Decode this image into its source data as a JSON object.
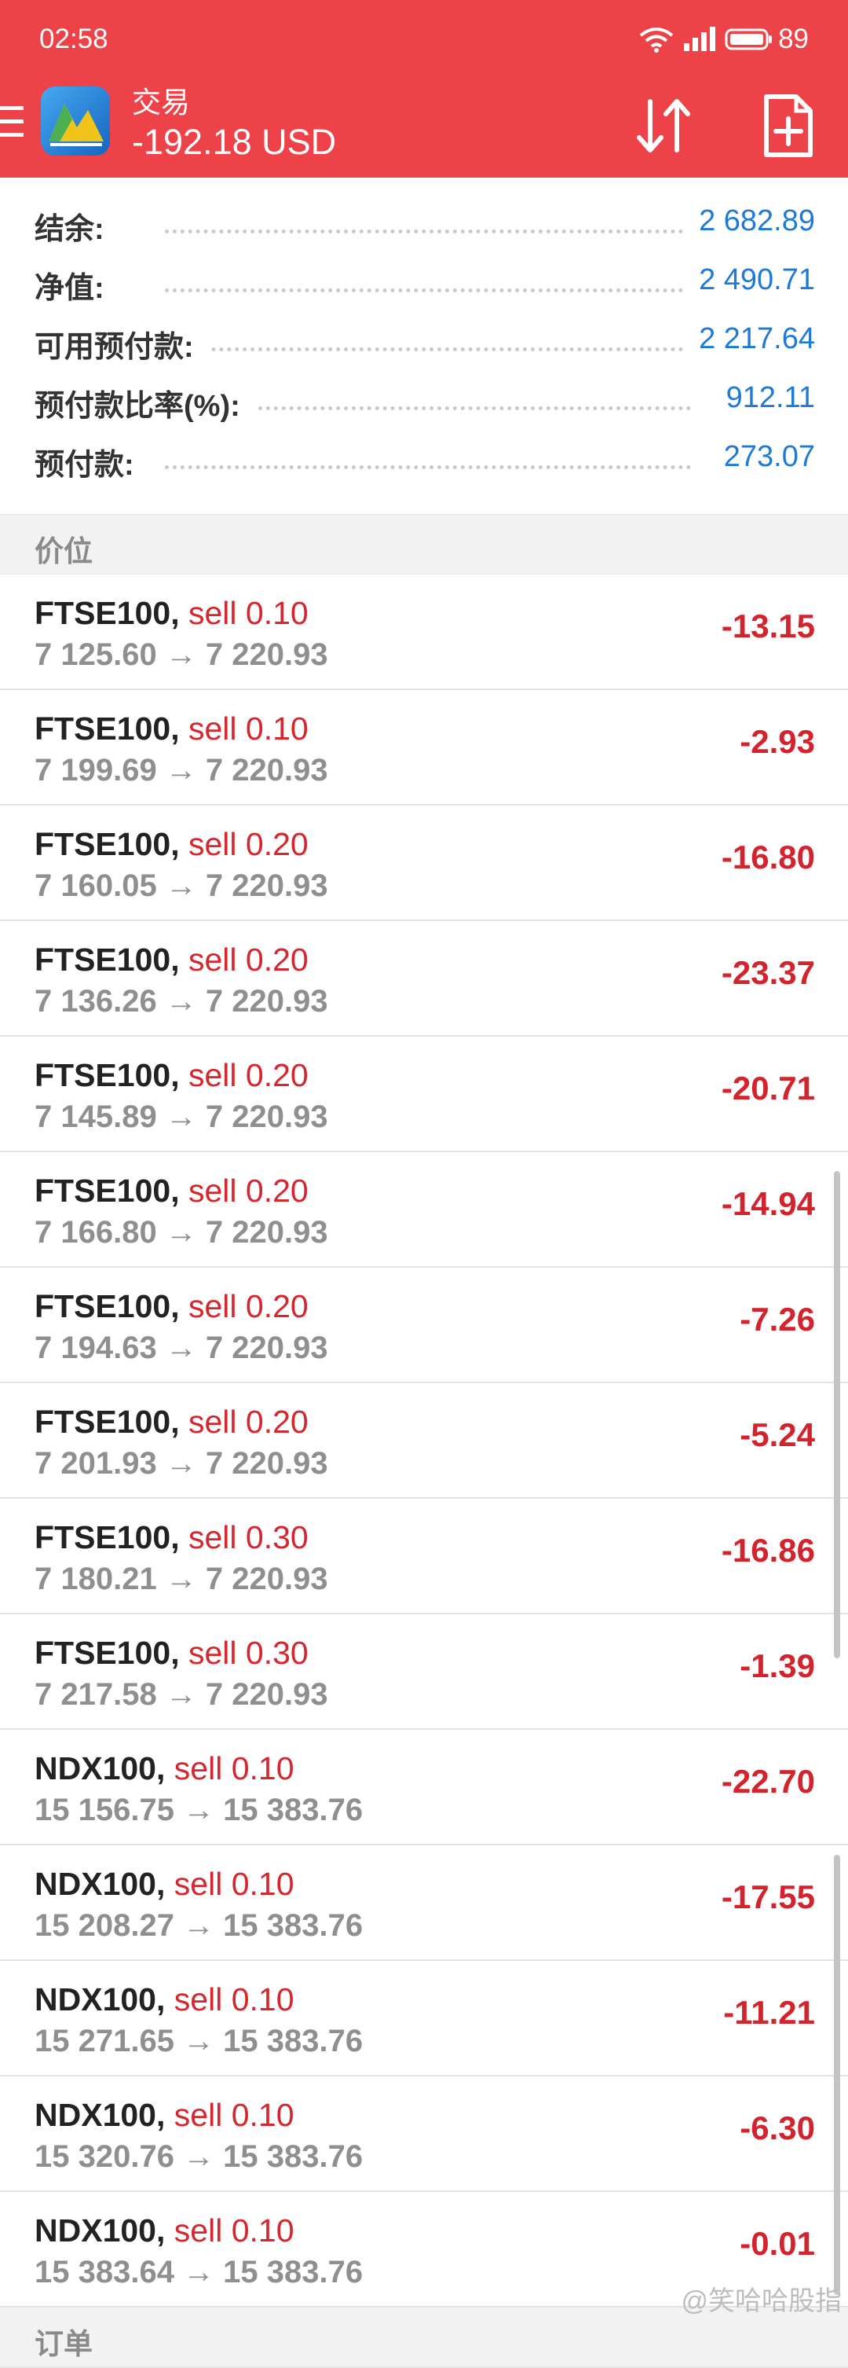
{
  "status_bar": {
    "time": "02:58",
    "battery": "89"
  },
  "header": {
    "title": "交易",
    "balance": "-192.18 USD"
  },
  "summary": [
    {
      "label": "结余:",
      "value": "2 682.89"
    },
    {
      "label": "净值:",
      "value": "2 490.71"
    },
    {
      "label": "可用预付款:",
      "value": "2 217.64"
    },
    {
      "label": "预付款比率(%):",
      "value": "912.11"
    },
    {
      "label": "预付款:",
      "value": "273.07"
    }
  ],
  "positions_header": "价位",
  "positions": [
    {
      "symbol": "FTSE100,",
      "side": "sell 0.10",
      "prices": "7 125.60 → 7 220.93",
      "profit": "-13.15"
    },
    {
      "symbol": "FTSE100,",
      "side": "sell 0.10",
      "prices": "7 199.69 → 7 220.93",
      "profit": "-2.93"
    },
    {
      "symbol": "FTSE100,",
      "side": "sell 0.20",
      "prices": "7 160.05 → 7 220.93",
      "profit": "-16.80"
    },
    {
      "symbol": "FTSE100,",
      "side": "sell 0.20",
      "prices": "7 136.26 → 7 220.93",
      "profit": "-23.37"
    },
    {
      "symbol": "FTSE100,",
      "side": "sell 0.20",
      "prices": "7 145.89 → 7 220.93",
      "profit": "-20.71"
    },
    {
      "symbol": "FTSE100,",
      "side": "sell 0.20",
      "prices": "7 166.80 → 7 220.93",
      "profit": "-14.94"
    },
    {
      "symbol": "FTSE100,",
      "side": "sell 0.20",
      "prices": "7 194.63 → 7 220.93",
      "profit": "-7.26"
    },
    {
      "symbol": "FTSE100,",
      "side": "sell 0.20",
      "prices": "7 201.93 → 7 220.93",
      "profit": "-5.24"
    },
    {
      "symbol": "FTSE100,",
      "side": "sell 0.30",
      "prices": "7 180.21 → 7 220.93",
      "profit": "-16.86"
    },
    {
      "symbol": "FTSE100,",
      "side": "sell 0.30",
      "prices": "7 217.58 → 7 220.93",
      "profit": "-1.39"
    },
    {
      "symbol": "NDX100,",
      "side": "sell 0.10",
      "prices": "15 156.75 → 15 383.76",
      "profit": "-22.70"
    },
    {
      "symbol": "NDX100,",
      "side": "sell 0.10",
      "prices": "15 208.27 → 15 383.76",
      "profit": "-17.55"
    },
    {
      "symbol": "NDX100,",
      "side": "sell 0.10",
      "prices": "15 271.65 → 15 383.76",
      "profit": "-11.21"
    },
    {
      "symbol": "NDX100,",
      "side": "sell 0.10",
      "prices": "15 320.76 → 15 383.76",
      "profit": "-6.30"
    },
    {
      "symbol": "NDX100,",
      "side": "sell 0.10",
      "prices": "15 383.64 → 15 383.76",
      "profit": "-0.01"
    }
  ],
  "orders_header": "订单",
  "watermark": "@笑哈哈股指",
  "icons": {
    "menu": "menu-icon",
    "logo": "app-logo",
    "sort": "sort-arrows-icon",
    "new_order": "add-document-icon",
    "wifi": "wifi-icon",
    "signal": "signal-icon",
    "battery": "battery-icon"
  },
  "colors": {
    "header_bg": "#ee4249",
    "value_blue": "#1e7ad6",
    "loss_red": "#d3232c"
  }
}
